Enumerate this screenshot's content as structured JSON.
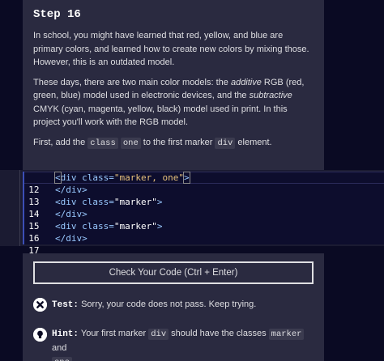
{
  "step": {
    "title": "Step 16",
    "p1": "In school, you might have learned that red, yellow, and blue are primary colors, and learned how to create new colors by mixing those. However, this is an outdated model.",
    "p2_a": "These days, there are two main color models: the ",
    "p2_em1": "additive",
    "p2_b": " RGB (red, green, blue) model used in electronic devices, and the ",
    "p2_em2": "subtractive",
    "p2_c": " CMYK (cyan, magenta, yellow, black) model used in print. In this project you'll work with the RGB model.",
    "p3_a": "First, add the ",
    "p3_code1": "class",
    "p3_sp": " ",
    "p3_code2": "one",
    "p3_b": " to the first marker ",
    "p3_code3": "div",
    "p3_c": " element."
  },
  "editor": {
    "lines": [
      {
        "num": "12",
        "open": "<",
        "tag": "div",
        "attr": " class=",
        "str": "\"marker, one\"",
        "close": ">"
      },
      {
        "num": "13",
        "text": "</div>"
      },
      {
        "num": "14",
        "open": "<",
        "tag": "div",
        "attr": " class=",
        "str": "\"marker\"",
        "close": ">"
      },
      {
        "num": "15",
        "text": "</div>"
      },
      {
        "num": "16",
        "open": "<",
        "tag": "div",
        "attr": " class=",
        "str": "\"marker\"",
        "close": ">"
      },
      {
        "num": "17",
        "text": "</div>"
      }
    ]
  },
  "actions": {
    "check_label": "Check Your Code (Ctrl + Enter)"
  },
  "test": {
    "label": "Test:",
    "message": " Sorry, your code does not pass. Keep trying."
  },
  "hint": {
    "label": "Hint:",
    "a": " Your first marker ",
    "code1": "div",
    "b": " should have the classes ",
    "code2": "marker",
    "c": " and ",
    "code3": "one",
    "d": "."
  },
  "colors": {
    "background": "#0a0a23",
    "panel": "#2a2a40",
    "editor": "#1b1b32",
    "string": "#e6c07b",
    "tag": "#99c9ff"
  }
}
